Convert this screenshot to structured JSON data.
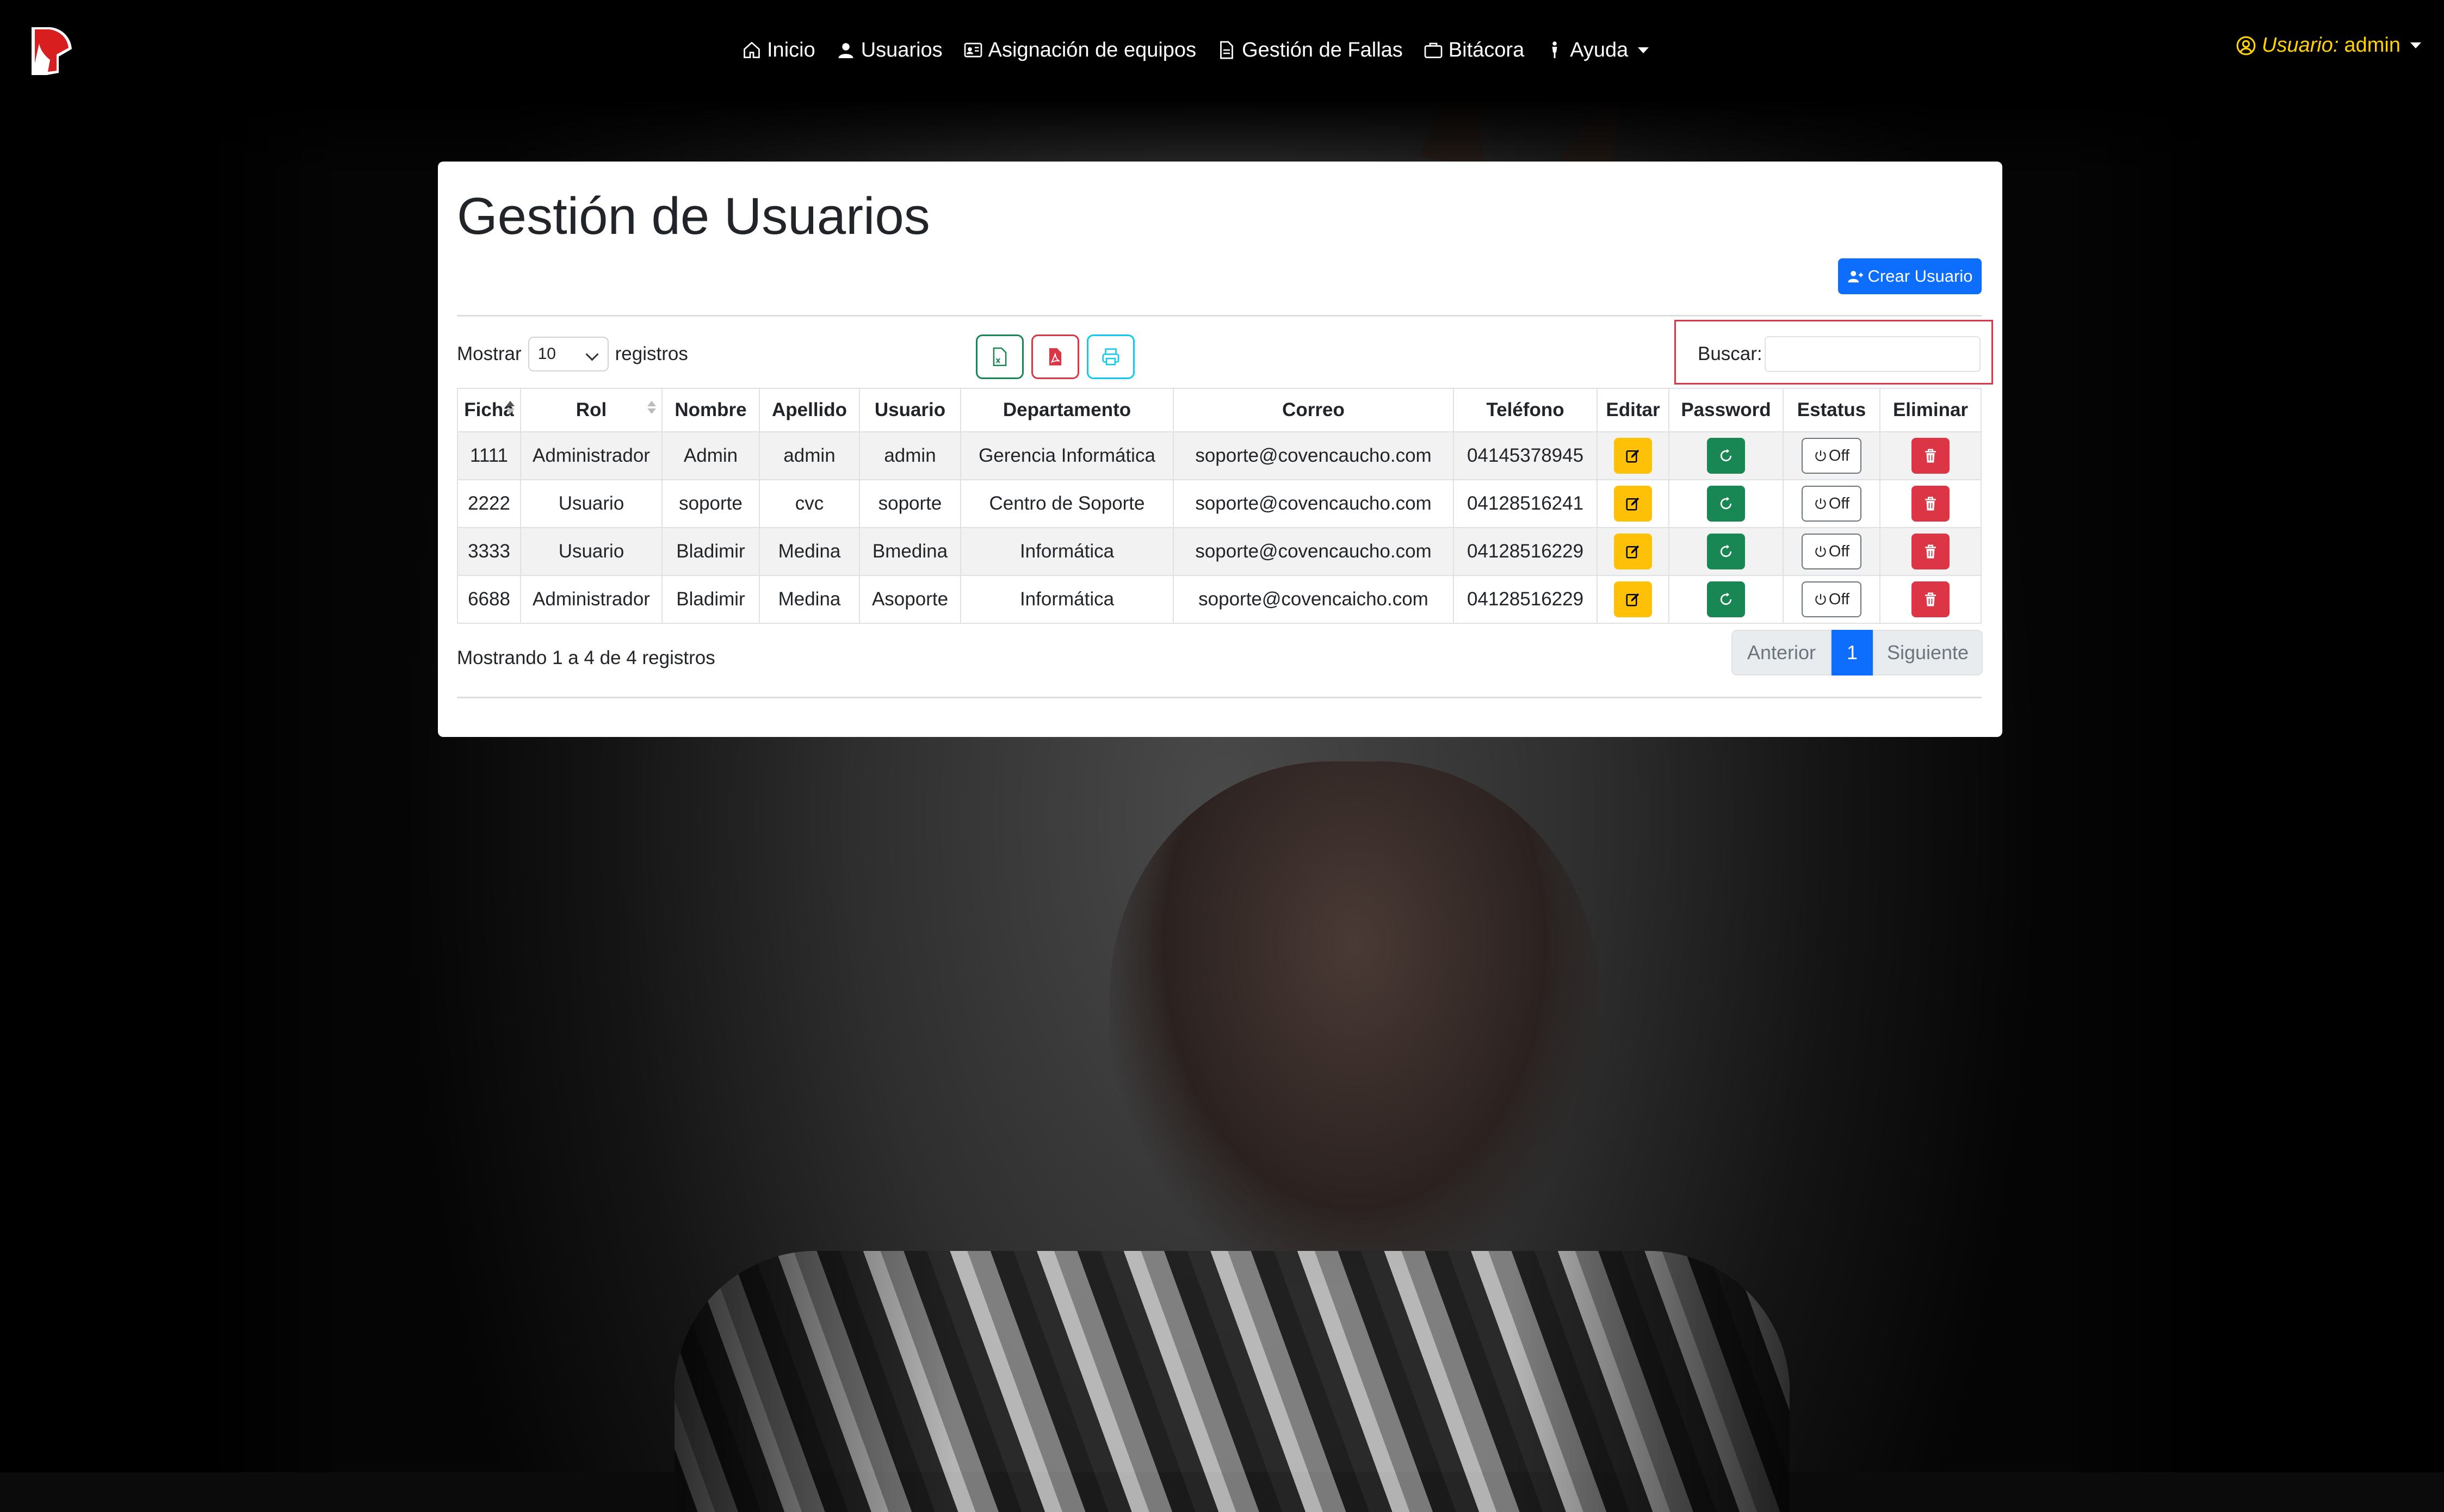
{
  "nav": {
    "items": [
      {
        "label": "Inicio",
        "icon": "home-icon"
      },
      {
        "label": "Usuarios",
        "icon": "user-icon"
      },
      {
        "label": "Asignación de equipos",
        "icon": "id-card-icon"
      },
      {
        "label": "Gestión de Fallas",
        "icon": "document-icon"
      },
      {
        "label": "Bitácora",
        "icon": "briefcase-icon"
      },
      {
        "label": "Ayuda",
        "icon": "person-help-icon"
      }
    ],
    "user_prefix": "Usuario:",
    "user_name": "admin"
  },
  "page": {
    "title": "Gestión de Usuarios",
    "create_label": "Crear Usuario"
  },
  "table_controls": {
    "show_label": "Mostrar",
    "page_length": "10",
    "records_label": "registros",
    "search_label": "Buscar:",
    "search_value": "",
    "export_buttons": [
      "excel-icon",
      "pdf-icon",
      "print-icon"
    ]
  },
  "table": {
    "headers": [
      "Ficha",
      "Rol",
      "Nombre",
      "Apellido",
      "Usuario",
      "Departamento",
      "Correo",
      "Teléfono",
      "Editar",
      "Password",
      "Estatus",
      "Eliminar"
    ],
    "rows": [
      {
        "ficha": "1111",
        "rol": "Administrador",
        "nombre": "Admin",
        "apellido": "admin",
        "usuario": "admin",
        "departamento": "Gerencia Informática",
        "correo": "soporte@covencaucho.com",
        "telefono": "04145378945",
        "estatus": "Off"
      },
      {
        "ficha": "2222",
        "rol": "Usuario",
        "nombre": "soporte",
        "apellido": "cvc",
        "usuario": "soporte",
        "departamento": "Centro de Soporte",
        "correo": "soporte@covencaucho.com",
        "telefono": "04128516241",
        "estatus": "Off"
      },
      {
        "ficha": "3333",
        "rol": "Usuario",
        "nombre": "Bladimir",
        "apellido": "Medina",
        "usuario": "Bmedina",
        "departamento": "Informática",
        "correo": "soporte@covencaucho.com",
        "telefono": "04128516229",
        "estatus": "Off"
      },
      {
        "ficha": "6688",
        "rol": "Administrador",
        "nombre": "Bladimir",
        "apellido": "Medina",
        "usuario": "Asoporte",
        "departamento": "Informática",
        "correo": "soporte@covencaicho.com",
        "telefono": "04128516229",
        "estatus": "Off"
      }
    ]
  },
  "footer": {
    "info": "Mostrando 1 a 4 de 4 registros",
    "prev": "Anterior",
    "current_page": "1",
    "next": "Siguiente"
  },
  "colors": {
    "primary": "#0d6efd",
    "warning": "#ffc107",
    "success": "#198754",
    "danger": "#dc3545",
    "user_accent": "#ffd200"
  }
}
